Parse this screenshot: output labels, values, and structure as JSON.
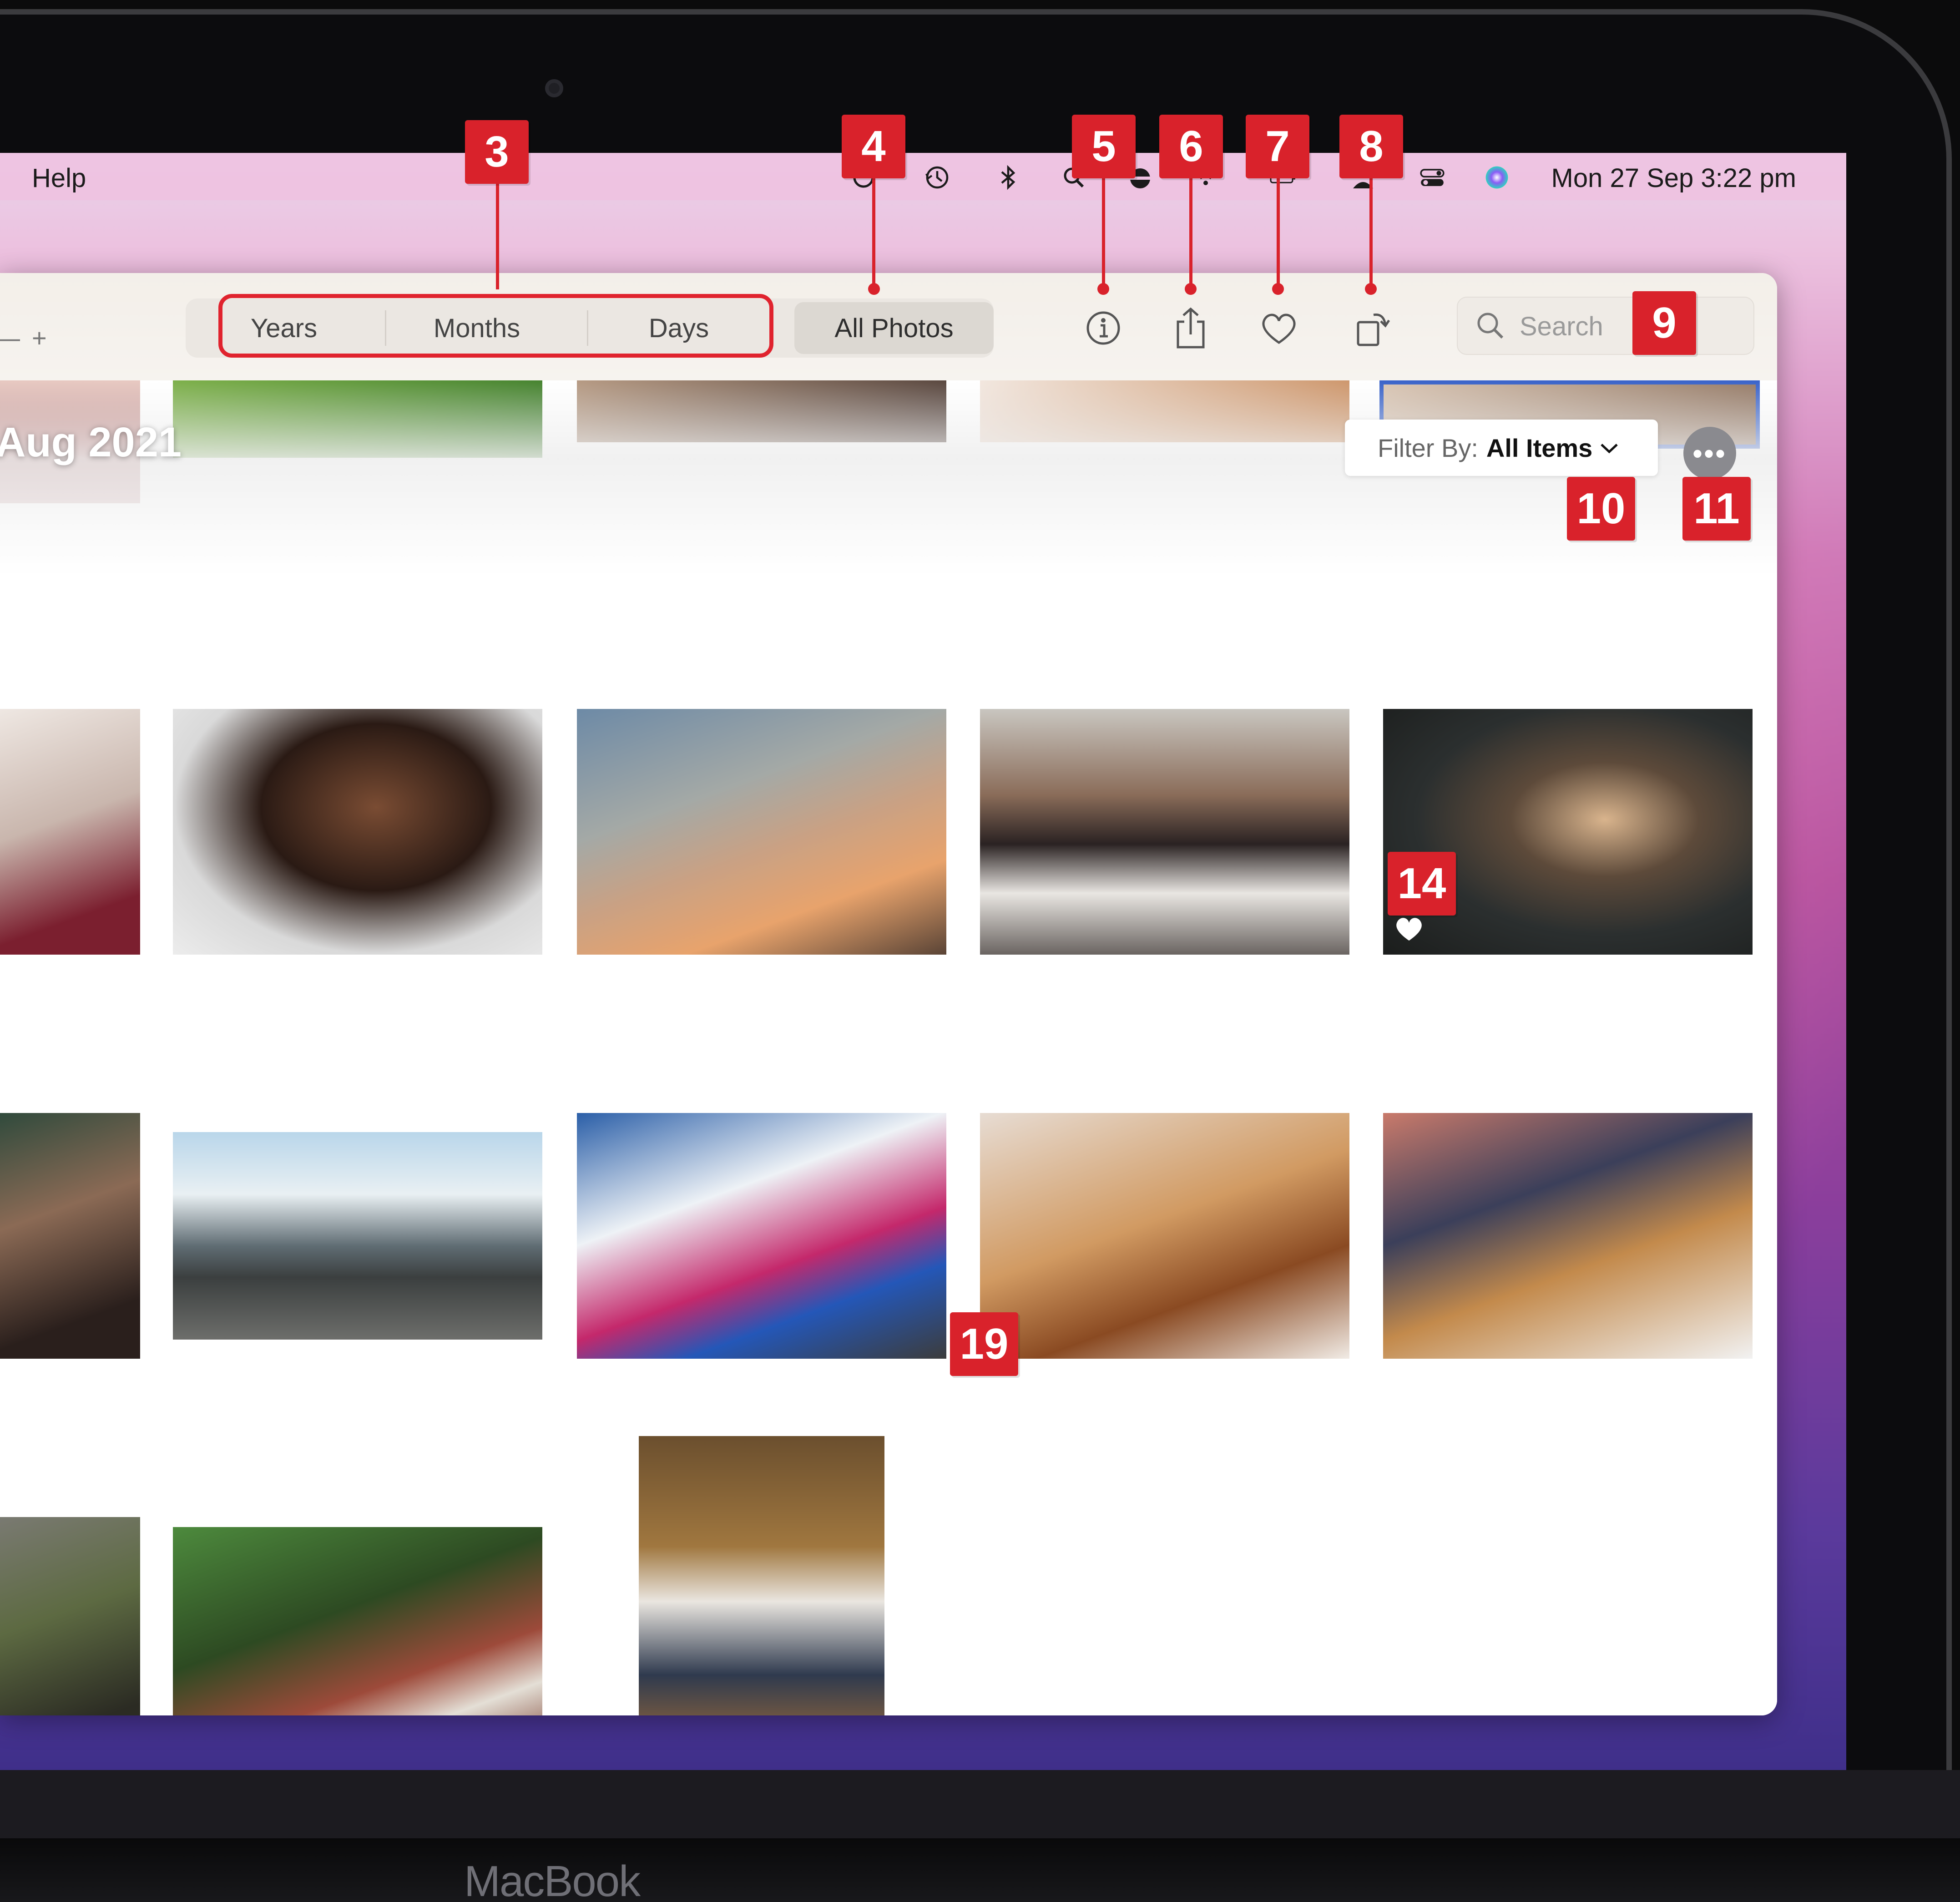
{
  "menubar": {
    "help": "Help",
    "clock": "Mon 27 Sep  3:22 pm"
  },
  "toolbar": {
    "zoom_minus": "—",
    "zoom_plus": "+",
    "views": [
      "Years",
      "Months",
      "Days"
    ],
    "all_photos": "All Photos",
    "search_placeholder": "Search"
  },
  "content": {
    "date_title": "Aug 2021",
    "filter_label": "Filter By:",
    "filter_value": "All Items",
    "more_glyph": "•••"
  },
  "callouts": {
    "c3": "3",
    "c4": "4",
    "c5": "5",
    "c6": "6",
    "c7": "7",
    "c8": "8",
    "c9": "9",
    "c10": "10",
    "c11": "11",
    "c14": "14",
    "c19": "19"
  },
  "device": {
    "brand": "MacBook"
  },
  "colors": {
    "accent_red": "#d9222b",
    "window_bg": "#ffffff"
  }
}
